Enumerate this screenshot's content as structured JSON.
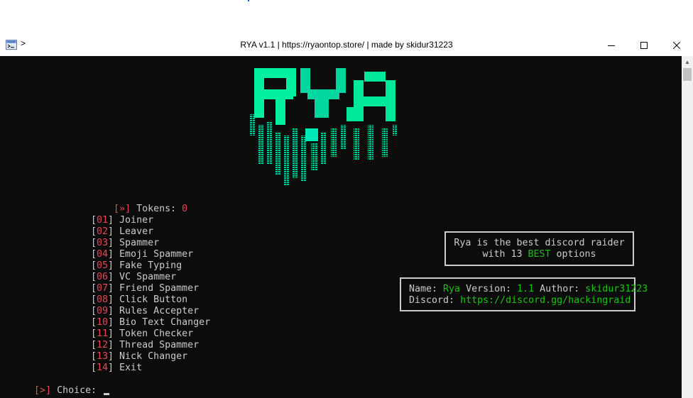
{
  "window": {
    "title": "RYA v1.1 | https://ryaontop.store/ | made by skidur31223",
    "caret": ">",
    "minimize_icon": "minimize-icon",
    "maximize_icon": "maximize-icon",
    "close_icon": "close-icon"
  },
  "logo": {
    "text": "RYA",
    "colors": [
      "#00ff9c",
      "#00c8a0",
      "#00a890"
    ]
  },
  "tokens": {
    "open": "[",
    "arrow": "»",
    "close": "]",
    "label": " Tokens: ",
    "value": "0"
  },
  "menu": [
    {
      "num": "01",
      "label": "Joiner"
    },
    {
      "num": "02",
      "label": "Leaver"
    },
    {
      "num": "03",
      "label": "Spammer"
    },
    {
      "num": "04",
      "label": "Emoji Spammer"
    },
    {
      "num": "05",
      "label": "Fake Typing"
    },
    {
      "num": "06",
      "label": "VC Spammer"
    },
    {
      "num": "07",
      "label": "Friend Spammer"
    },
    {
      "num": "08",
      "label": "Click Button"
    },
    {
      "num": "09",
      "label": "Rules Accepter"
    },
    {
      "num": "10",
      "label": "Bio Text Changer"
    },
    {
      "num": "11",
      "label": "Token Checker"
    },
    {
      "num": "12",
      "label": "Thread Spammer"
    },
    {
      "num": "13",
      "label": "Nick Changer"
    },
    {
      "num": "14",
      "label": "Exit"
    }
  ],
  "info_box": {
    "line1": "Rya is the best discord raider",
    "line2_pre": "with 13 ",
    "line2_hl": "BEST",
    "line2_post": " options"
  },
  "details_box": {
    "name_label": "Name: ",
    "name_value": "Rya",
    "version_label": " Version: ",
    "version_value": "1.1",
    "author_label": " Author: ",
    "author_value": "skidur31223",
    "discord_label": "Discord: ",
    "discord_value": "https://discord.gg/hackingraid"
  },
  "prompt": {
    "open": "[",
    "arrow": ">",
    "close": "]",
    "label": " Choice: "
  },
  "colors": {
    "accent_red": "#e74856",
    "accent_green": "#16c60c",
    "terminal_bg": "#0c0c0c",
    "text": "#cccccc"
  }
}
